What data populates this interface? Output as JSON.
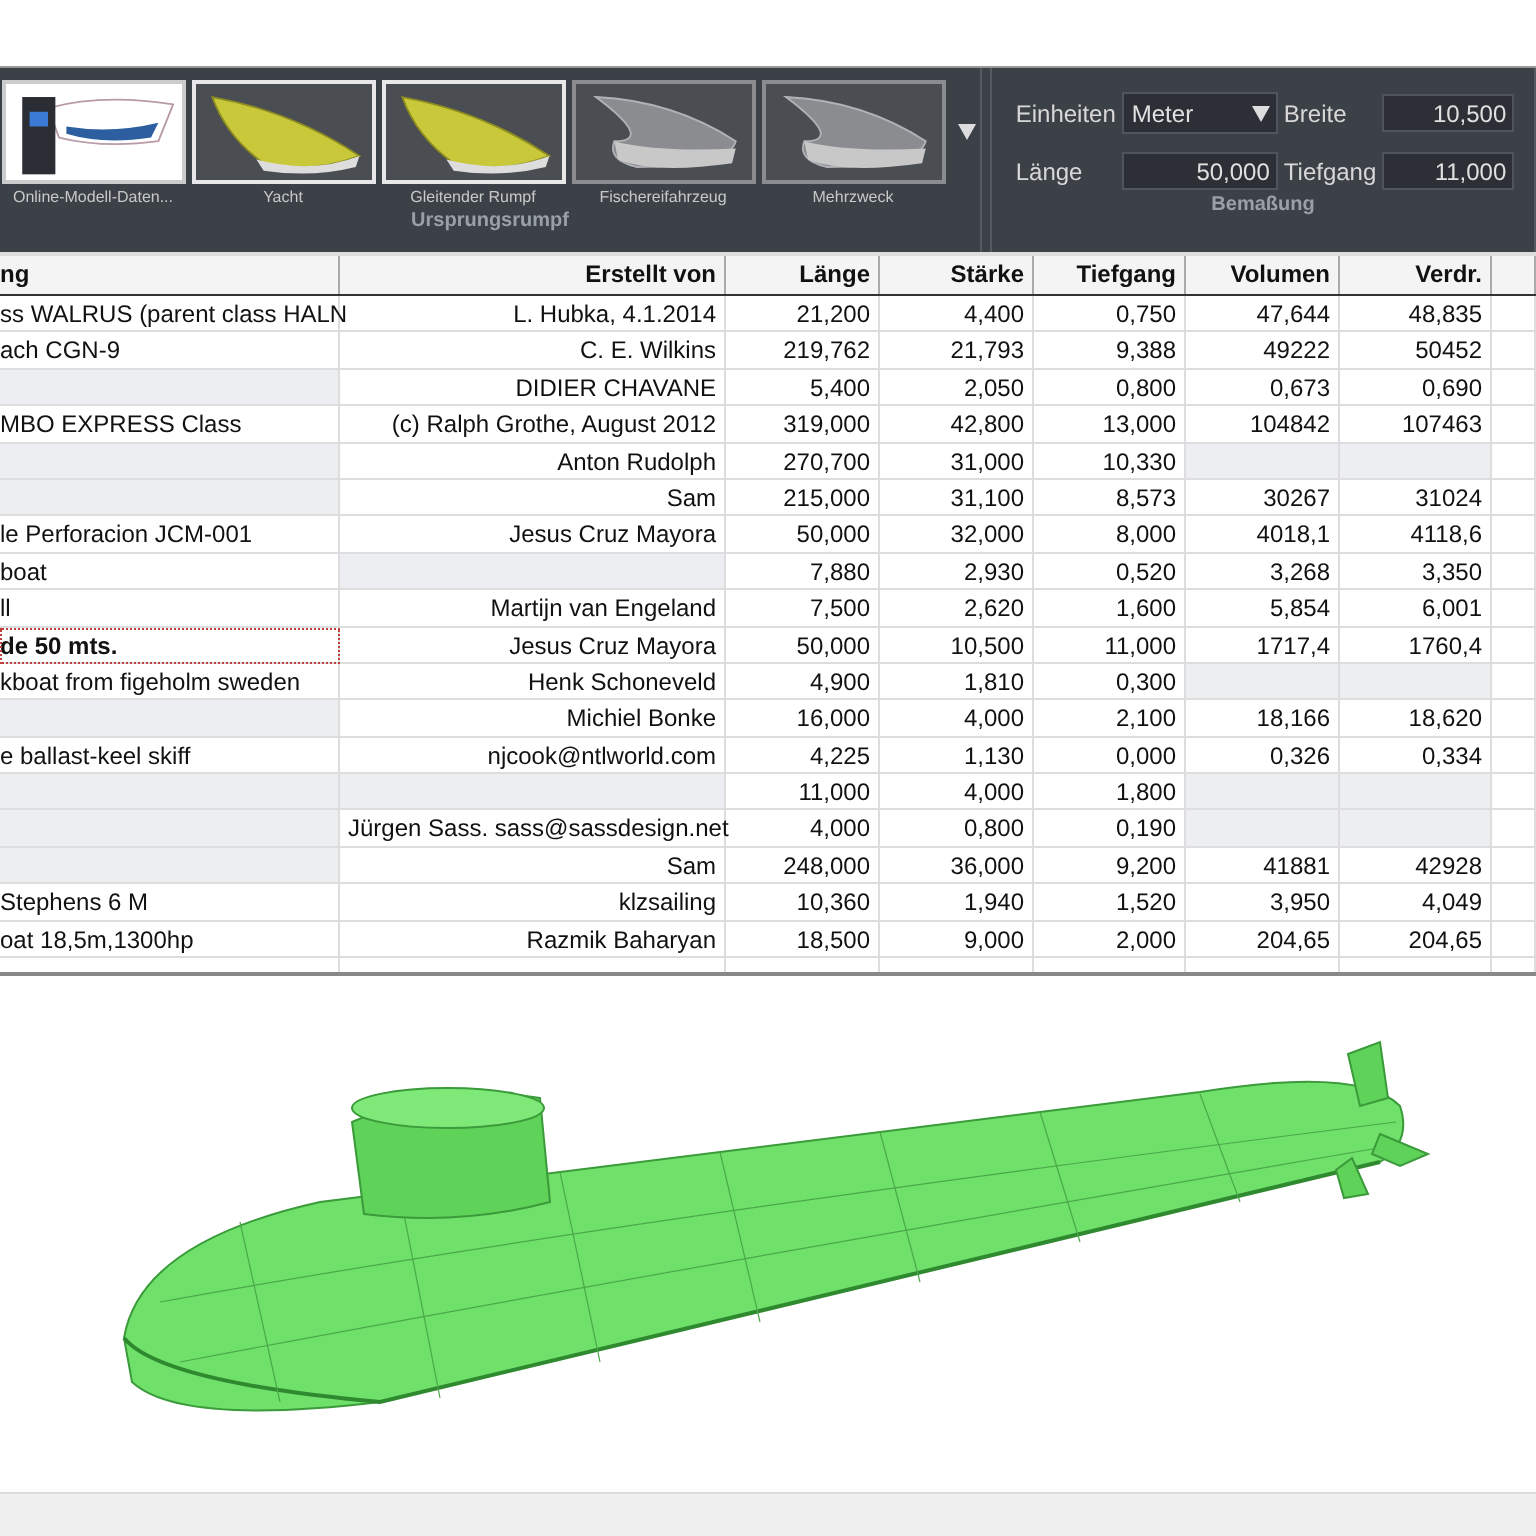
{
  "gallery": {
    "items": [
      {
        "label": "Online-Modell-Daten...",
        "kind": "online"
      },
      {
        "label": "Yacht",
        "kind": "yellow"
      },
      {
        "label": "Gleitender Rumpf",
        "kind": "yellow"
      },
      {
        "label": "Fischereifahrzeug",
        "kind": "grey"
      },
      {
        "label": "Mehrzweck",
        "kind": "grey"
      }
    ],
    "caption": "Ursprungsrumpf"
  },
  "dimensions": {
    "caption": "Bemaßung",
    "units_label": "Einheiten",
    "units_value": "Meter",
    "width_label": "Breite",
    "width_value": "10,500",
    "length_label": "Länge",
    "length_value": "50,000",
    "draft_label": "Tiefgang",
    "draft_value": "11,000"
  },
  "table": {
    "columns": [
      "ng",
      "Erstellt von",
      "Länge",
      "Stärke",
      "Tiefgang",
      "Volumen",
      "Verdr."
    ],
    "rows": [
      {
        "selected": false,
        "cells": [
          "ss WALRUS (parent class HALN",
          "L. Hubka, 4.1.2014",
          "21,200",
          "4,400",
          "0,750",
          "47,644",
          "48,835"
        ]
      },
      {
        "selected": false,
        "cells": [
          "ach CGN-9",
          "C. E. Wilkins",
          "219,762",
          "21,793",
          "9,388",
          "49222",
          "50452"
        ]
      },
      {
        "selected": false,
        "cells": [
          null,
          "DIDIER CHAVANE",
          "5,400",
          "2,050",
          "0,800",
          "0,673",
          "0,690"
        ]
      },
      {
        "selected": false,
        "cells": [
          "MBO EXPRESS Class",
          "(c) Ralph Grothe, August 2012",
          "319,000",
          "42,800",
          "13,000",
          "104842",
          "107463"
        ]
      },
      {
        "selected": false,
        "cells": [
          null,
          "Anton Rudolph",
          "270,700",
          "31,000",
          "10,330",
          null,
          null
        ]
      },
      {
        "selected": false,
        "cells": [
          null,
          "Sam",
          "215,000",
          "31,100",
          "8,573",
          "30267",
          "31024"
        ]
      },
      {
        "selected": false,
        "cells": [
          "le Perforacion JCM-001",
          "Jesus Cruz Mayora",
          "50,000",
          "32,000",
          "8,000",
          "4018,1",
          "4118,6"
        ]
      },
      {
        "selected": false,
        "cells": [
          "boat",
          null,
          "7,880",
          "2,930",
          "0,520",
          "3,268",
          "3,350"
        ]
      },
      {
        "selected": false,
        "cells": [
          "ll",
          "Martijn van Engeland",
          "7,500",
          "2,620",
          "1,600",
          "5,854",
          "6,001"
        ]
      },
      {
        "selected": true,
        "cells": [
          "de 50 mts.",
          "Jesus Cruz Mayora",
          "50,000",
          "10,500",
          "11,000",
          "1717,4",
          "1760,4"
        ]
      },
      {
        "selected": false,
        "cells": [
          "kboat from figeholm sweden",
          "Henk Schoneveld",
          "4,900",
          "1,810",
          "0,300",
          null,
          null
        ]
      },
      {
        "selected": false,
        "cells": [
          null,
          "Michiel Bonke",
          "16,000",
          "4,000",
          "2,100",
          "18,166",
          "18,620"
        ]
      },
      {
        "selected": false,
        "cells": [
          "e ballast-keel skiff",
          "njcook@ntlworld.com",
          "4,225",
          "1,130",
          "0,000",
          "0,326",
          "0,334"
        ]
      },
      {
        "selected": false,
        "cells": [
          null,
          null,
          "11,000",
          "4,000",
          "1,800",
          null,
          null
        ]
      },
      {
        "selected": false,
        "cells": [
          null,
          "Jürgen Sass. sass@sassdesign.net",
          "4,000",
          "0,800",
          "0,190",
          null,
          null
        ]
      },
      {
        "selected": false,
        "cells": [
          null,
          "Sam",
          "248,000",
          "36,000",
          "9,200",
          "41881",
          "42928"
        ]
      },
      {
        "selected": false,
        "cells": [
          "Stephens 6 M",
          "klzsailing",
          "10,360",
          "1,940",
          "1,520",
          "3,950",
          "4,049"
        ]
      },
      {
        "selected": false,
        "cells": [
          "oat 18,5m,1300hp",
          "Razmik Baharyan",
          "18,500",
          "9,000",
          "2,000",
          "204,65",
          "204,65"
        ]
      }
    ]
  }
}
